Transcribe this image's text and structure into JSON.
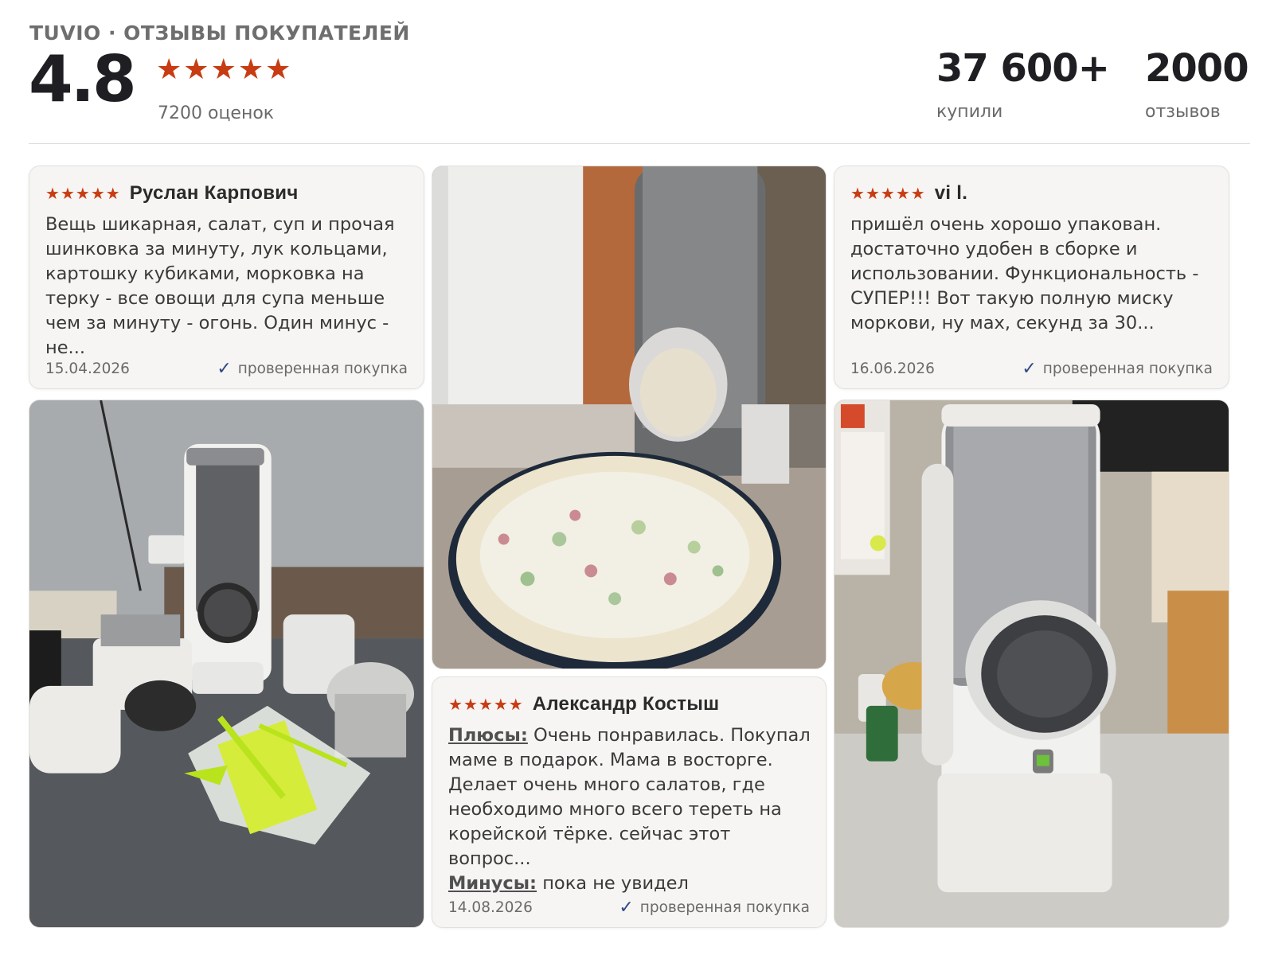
{
  "header": {
    "brand": "TUVIO · ОТЗЫВЫ ПОКУПАТЕЛЕЙ",
    "rating": "4.8",
    "stars": 5,
    "ratings_count": "7200 оценок",
    "stats": [
      {
        "value": "37 600+",
        "label": "купили"
      },
      {
        "value": "2000",
        "label": "отзывов"
      }
    ]
  },
  "reviews": [
    {
      "author": "Руслан Карпович",
      "stars": 5,
      "text": "Вещь шикарная, салат, суп и прочая шинковка за минуту, лук кольцами, картошку кубиками, морковка на терку - все овощи для супа меньше чем за минуту - огонь. Один минус - не...",
      "date": "15.04.2026",
      "verified": "проверенная покупка"
    },
    {
      "author": "vi l.",
      "stars": 5,
      "text": "пришёл очень хорошо упакован. достаточно удобен в сборке и использовании. Функциональность - СУПЕР!!! Вот такую полную миску моркови, ну мах, секунд за 30...",
      "date": "16.06.2026",
      "verified": "проверенная покупка"
    },
    {
      "author": "Александр Костыш",
      "stars": 5,
      "pros_label": "Плюсы:",
      "pros": "Очень понравилась. Покупал маме в подарок. Мама в восторге. Делает очень много салатов, где необходимо много всего тереть на корейской тёрке. сейчас этот вопрос...",
      "cons_label": "Минусы:",
      "cons": "пока не увидел",
      "date": "14.08.2026",
      "verified": "проверенная покупка"
    }
  ],
  "colors": {
    "star": "#c73c12",
    "check": "#2d4a86"
  }
}
